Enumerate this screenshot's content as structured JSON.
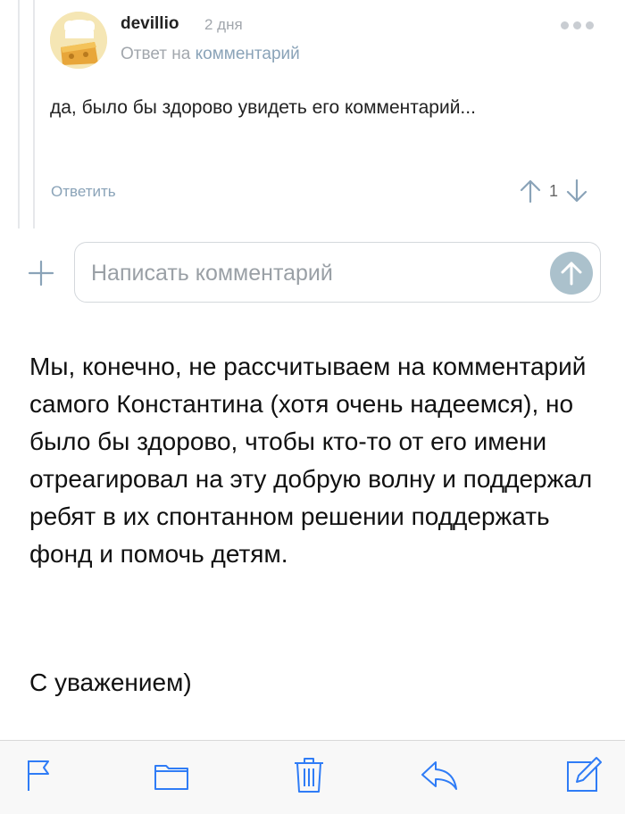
{
  "comment": {
    "author": "devillio",
    "date": "2 дня",
    "reply_prefix": "Ответ на",
    "reply_link": "комментарий",
    "text": "да, было бы здорово увидеть его комментарий...",
    "reply_label": "Ответить",
    "vote_count": "1"
  },
  "composer": {
    "placeholder": "Написать комментарий"
  },
  "letter": {
    "body": "Мы, конечно, не рассчитываем на комментарий самого Константина (хотя очень надеемся), но было бы здорово, чтобы кто-то от его имени отреагировал на эту добрую волну и поддержал ребят в их спонтанном решении поддержать фонд и помочь детям.",
    "signoff": "С уважением)"
  },
  "toolbar": {
    "icons": [
      "flag-icon",
      "folder-icon",
      "trash-icon",
      "reply-icon",
      "compose-icon"
    ]
  },
  "colors": {
    "accent": "#8aa3b8",
    "send_button": "#abc1cc",
    "muted_text": "#a2a7ad",
    "toolbar_icon": "#2f7cf6"
  }
}
